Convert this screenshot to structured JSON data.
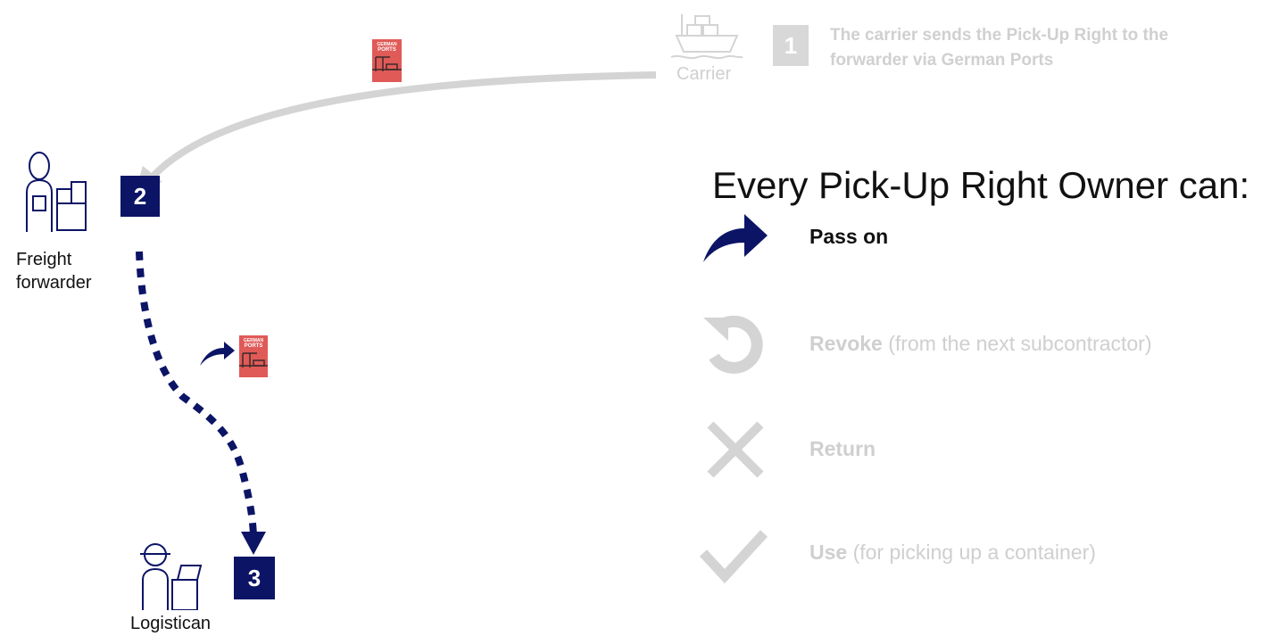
{
  "carrier": {
    "label": "Carrier"
  },
  "step1": {
    "number": "1",
    "text_line1": "The carrier sends the Pick-Up Right to the",
    "text_line2": "forwarder via German Ports"
  },
  "forwarder": {
    "label_line1": "Freight",
    "label_line2": "forwarder",
    "step": "2"
  },
  "logistician": {
    "label": "Logistican",
    "step": "3"
  },
  "logo": {
    "line1": "GERMAN",
    "line2": "PORTS"
  },
  "heading": "Every Pick-Up Right Owner can:",
  "actions": [
    {
      "name": "Pass on",
      "detail": ""
    },
    {
      "name": "Revoke",
      "detail": " (from the next subcontractor)"
    },
    {
      "name": "Return",
      "detail": ""
    },
    {
      "name": "Use",
      "detail": " (for picking up a container)"
    }
  ],
  "colors": {
    "navy": "#0c1466",
    "gray": "#d4d4d4",
    "logo": "#e05a57"
  }
}
